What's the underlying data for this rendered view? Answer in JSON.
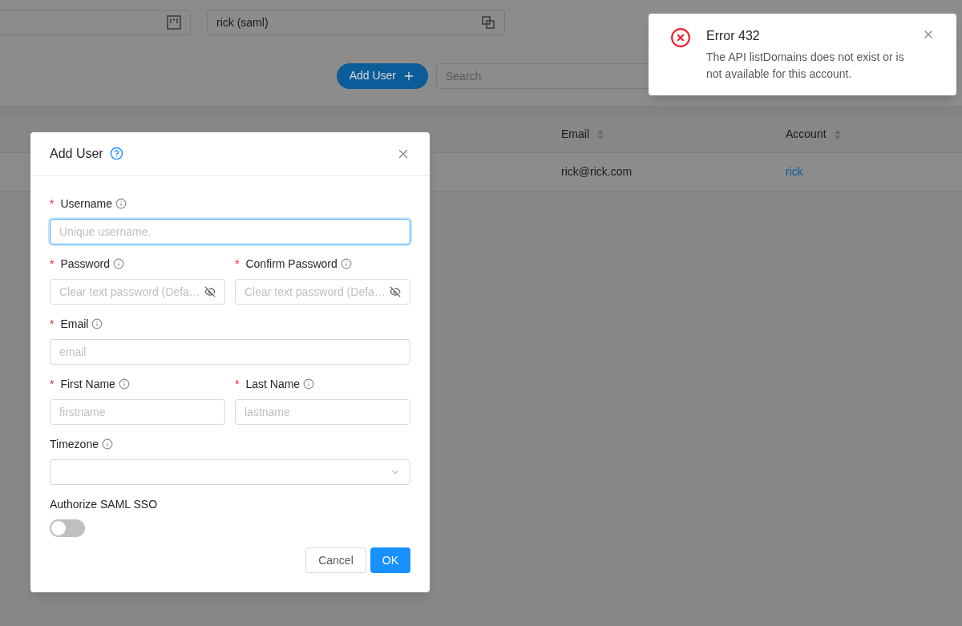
{
  "top_bar": {
    "account_field": {
      "value": "rick (saml)"
    }
  },
  "toolbar": {
    "add_button": "Add User",
    "search": {
      "placeholder": "Search"
    }
  },
  "table": {
    "columns": [
      {
        "label": "Email"
      },
      {
        "label": "Account"
      }
    ],
    "rows": [
      {
        "email": "rick@rick.com",
        "account": "rick"
      }
    ]
  },
  "dialog": {
    "title": "Add User",
    "rows": [
      {
        "fields": [
          {
            "label": "Username",
            "required_mark": "*",
            "info": true,
            "kind": "text",
            "placeholder": "Unique username.",
            "focused": true
          }
        ]
      },
      {
        "fields": [
          {
            "label": "Password",
            "required_mark": "*",
            "info": true,
            "kind": "password",
            "placeholder": "Clear text password (Defa…",
            "focused": false
          },
          {
            "label": "Confirm Password",
            "required_mark": "*",
            "info": true,
            "kind": "password",
            "placeholder": "Clear text password (Defa…",
            "focused": false
          }
        ]
      },
      {
        "fields": [
          {
            "label": "Email",
            "required_mark": "*",
            "info": true,
            "kind": "text",
            "placeholder": "email",
            "focused": false
          }
        ]
      },
      {
        "fields": [
          {
            "label": "First Name",
            "required_mark": "*",
            "info": true,
            "kind": "text",
            "placeholder": "firstname",
            "focused": false
          },
          {
            "label": "Last Name",
            "required_mark": "*",
            "info": true,
            "kind": "text",
            "placeholder": "lastname",
            "focused": false
          }
        ]
      },
      {
        "fields": [
          {
            "label": "Timezone",
            "info": true,
            "kind": "select",
            "focused": false
          }
        ]
      },
      {
        "fields": [
          {
            "label": "Authorize SAML SSO",
            "info": false,
            "kind": "switch",
            "on": false
          }
        ]
      }
    ],
    "buttons": [
      {
        "label": "Cancel",
        "primary": false
      },
      {
        "label": "OK",
        "primary": true
      }
    ]
  },
  "notification": {
    "title": "Error 432",
    "message": "The API listDomains does not exist or is not available for this account."
  }
}
